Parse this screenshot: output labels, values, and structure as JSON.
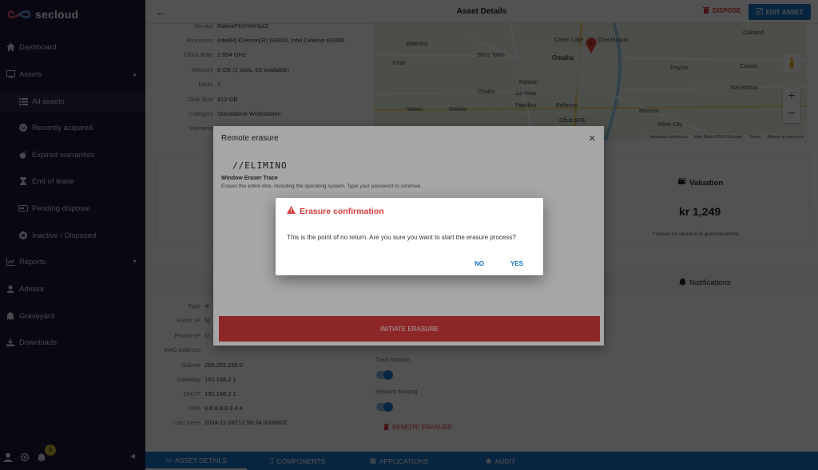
{
  "app": {
    "name": "secloud"
  },
  "sidebar": {
    "items": [
      {
        "label": "Dashboard",
        "icon": "home-icon"
      },
      {
        "label": "Assets",
        "icon": "monitor-icon"
      },
      {
        "label": "All assets",
        "icon": "list-icon"
      },
      {
        "label": "Recently acquired",
        "icon": "smile-icon"
      },
      {
        "label": "Expired warranties",
        "icon": "bomb-icon"
      },
      {
        "label": "End of lease",
        "icon": "hourglass-icon"
      },
      {
        "label": "Pending disposal",
        "icon": "tag-icon"
      },
      {
        "label": "Inactive / Disposed",
        "icon": "ban-icon"
      },
      {
        "label": "Reports",
        "icon": "chart-icon"
      },
      {
        "label": "Advisor",
        "icon": "user-icon"
      },
      {
        "label": "Graveyard",
        "icon": "ghost-icon"
      },
      {
        "label": "Downloads",
        "icon": "download-icon"
      }
    ],
    "notification_count": "3"
  },
  "header": {
    "title": "Asset Details",
    "dispose_label": "DISPOSE",
    "edit_label": "EDIT ASSET"
  },
  "specs": [
    {
      "label": "Vendor",
      "value": "RdekeFKtYhW1plZ"
    },
    {
      "label": "Processor",
      "value": "Intel(R) Celeron(R) G6900, Intel Celeron G6900"
    },
    {
      "label": "Clock Rate",
      "value": "2.594 GHz"
    },
    {
      "label": "Memory",
      "value": "8 GB (1 slots, 63 available)"
    },
    {
      "label": "Disks",
      "value": "1"
    },
    {
      "label": "Disk Size",
      "value": "412 GB"
    },
    {
      "label": "Category",
      "value": "Standalone Workstation"
    },
    {
      "label": "Warranty",
      "value": ""
    }
  ],
  "map": {
    "labels": [
      "Waterloo",
      "Carter Lake",
      "Chautauqua",
      "Oakland",
      "Boys Town",
      "Omaha",
      "Yutan",
      "Treynor",
      "Carson",
      "Ralston",
      "Macedonia",
      "Chalco",
      "La Vista",
      "Wann",
      "Gretna",
      "Papillion",
      "Bellevue",
      "Offutt AFB",
      "Mineola",
      "Silver City"
    ],
    "footer": [
      "Keyboard shortcuts",
      "Map Data ©2025 Google",
      "Terms",
      "Report a map error"
    ]
  },
  "valuation": {
    "title": "Valuation",
    "amount": "kr 1,249",
    "note": "* based on secloud AI guesstimations"
  },
  "notifications_tab": "Notifications",
  "network": [
    {
      "label": "Type",
      "value": ""
    },
    {
      "label": "Public IP",
      "value": "1("
    },
    {
      "label": "Private IP",
      "value": "1!"
    },
    {
      "label": "MAC Address",
      "value": ""
    },
    {
      "label": "Subnet",
      "value": "255.255.255.0"
    },
    {
      "label": "Gateway",
      "value": "192.168.2.1"
    },
    {
      "label": "DHCP",
      "value": "192.168.2.1"
    },
    {
      "label": "DNS",
      "value": "8.8.8.8,8.8.4.4"
    },
    {
      "label": "Last Seen",
      "value": "2024-11-28T12:56:34.000000Z"
    }
  ],
  "toggles": {
    "track_location": "Track location",
    "network_tracking": "Network tracking",
    "remote_erasure": "REMOTE ERASURE"
  },
  "bottom_tabs": [
    "ASSET DETAILS",
    "COMPONENTS",
    "APPLICATIONS",
    "AUDIT"
  ],
  "remote_dialog": {
    "title": "Remote erasure",
    "brand": "//ELIMINO",
    "subtitle": "Window Eraser Trace",
    "desc": "Erases the entire disk, including the operating system. Type your password to continue.",
    "button": "INITIATE ERASURE"
  },
  "confirm_dialog": {
    "title": "Erasure confirmation",
    "message": "This is the point of no return. Are you sure you want to start the erasure process?",
    "no": "NO",
    "yes": "YES"
  }
}
